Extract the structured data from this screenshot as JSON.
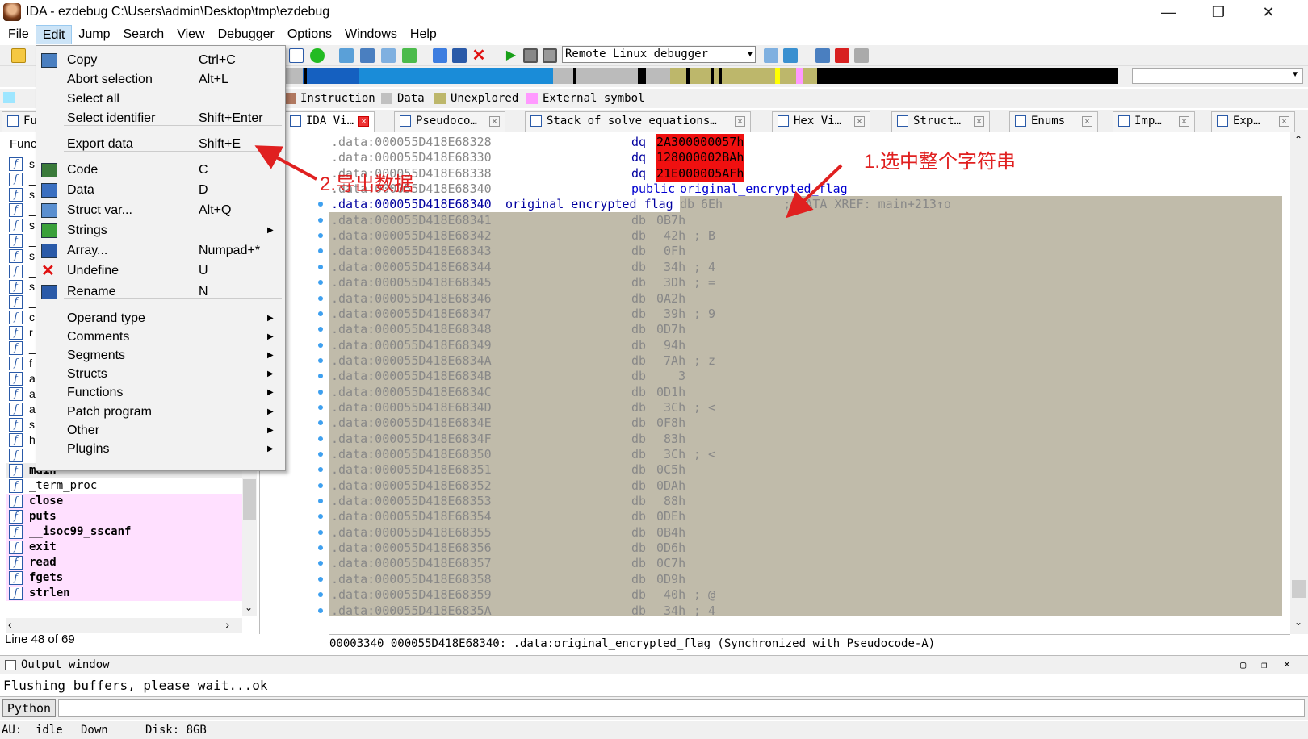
{
  "window": {
    "title": "IDA - ezdebug C:\\Users\\admin\\Desktop\\tmp\\ezdebug",
    "minimize": "—",
    "restore": "❐",
    "close": "✕"
  },
  "menubar": {
    "items": [
      "File",
      "Edit",
      "Jump",
      "Search",
      "View",
      "Debugger",
      "Options",
      "Windows",
      "Help"
    ],
    "active": "Edit"
  },
  "toolbar": {
    "debugger_select": "Remote Linux debugger"
  },
  "legend": [
    {
      "label": "Instruction",
      "color": "#b07860"
    },
    {
      "label": "Data",
      "color": "#c0c0c0"
    },
    {
      "label": "Unexplored",
      "color": "#bdb76b"
    },
    {
      "label": "External symbol",
      "color": "#ff99ff"
    }
  ],
  "tabs": [
    {
      "label": "Fu"
    },
    {
      "label": "IDA Vi…",
      "active": true
    },
    {
      "label": "Pseudoco…"
    },
    {
      "label": "Stack of solve_equations…"
    },
    {
      "label": "Hex Vi…"
    },
    {
      "label": "Struct…"
    },
    {
      "label": "Enums"
    },
    {
      "label": "Imp…"
    },
    {
      "label": "Exp…"
    }
  ],
  "functions_panel": {
    "header": "Func",
    "partial_rows": [
      "s",
      "_",
      "s",
      "_",
      "s",
      "_",
      "s",
      "_",
      "s",
      "_",
      "c",
      "r",
      "_",
      "f",
      "a",
      "a",
      "a",
      "s",
      "h"
    ],
    "rows": [
      {
        "name": "_pre_pad",
        "style": "normal"
      },
      {
        "name": "main",
        "style": "bold"
      },
      {
        "name": "_term_proc",
        "style": "normal"
      },
      {
        "name": "close",
        "style": "pink"
      },
      {
        "name": "puts",
        "style": "pink"
      },
      {
        "name": "__isoc99_sscanf",
        "style": "pink"
      },
      {
        "name": "exit",
        "style": "pink"
      },
      {
        "name": "read",
        "style": "pink"
      },
      {
        "name": "fgets",
        "style": "pink"
      },
      {
        "name": "strlen",
        "style": "pink"
      }
    ],
    "line_info": "Line 48 of 69"
  },
  "edit_menu": {
    "items": [
      {
        "label": "Copy",
        "shortcut": "Ctrl+C",
        "icon": "copy-icon"
      },
      {
        "label": "Abort selection",
        "shortcut": "Alt+L"
      },
      {
        "label": "Select all",
        "shortcut": ""
      },
      {
        "label": "Select identifier",
        "shortcut": "Shift+Enter"
      },
      {
        "label": "Export data",
        "shortcut": "Shift+E",
        "highlighted": true
      },
      {
        "label": "Code",
        "shortcut": "C",
        "icon": "code-icon"
      },
      {
        "label": "Data",
        "shortcut": "D",
        "icon": "data-icon"
      },
      {
        "label": "Struct var...",
        "shortcut": "Alt+Q",
        "icon": "struct-var-icon"
      },
      {
        "label": "Strings",
        "shortcut": "",
        "submenu": true,
        "icon": "strings-icon"
      },
      {
        "label": "Array...",
        "shortcut": "Numpad+*",
        "icon": "array-icon"
      },
      {
        "label": "Undefine",
        "shortcut": "U",
        "icon": "undefine-icon"
      },
      {
        "label": "Rename",
        "shortcut": "N",
        "icon": "rename-icon"
      },
      {
        "label": "Operand type",
        "submenu": true
      },
      {
        "label": "Comments",
        "submenu": true
      },
      {
        "label": "Segments",
        "submenu": true
      },
      {
        "label": "Structs",
        "submenu": true
      },
      {
        "label": "Functions",
        "submenu": true
      },
      {
        "label": "Patch program",
        "submenu": true
      },
      {
        "label": "Other",
        "submenu": true
      },
      {
        "label": "Plugins",
        "submenu": true
      }
    ]
  },
  "listing": {
    "rows": [
      {
        "addr": ".data:000055D418E68328",
        "name": "",
        "op": "dq",
        "val": "2A300000057h",
        "cmt": "",
        "red": true
      },
      {
        "addr": ".data:000055D418E68330",
        "name": "",
        "op": "dq",
        "val": "128000002BAh",
        "cmt": "",
        "red": true
      },
      {
        "addr": ".data:000055D418E68338",
        "name": "",
        "op": "dq",
        "val": "21E000005AFh",
        "cmt": "",
        "red": true
      },
      {
        "addr": ".data:000055D418E68340",
        "name": "",
        "op": "public",
        "val": "original_encrypted_flag",
        "cmt": "",
        "public": true
      },
      {
        "addr": ".data:000055D418E68340",
        "name": "original_encrypted_flag",
        "op": "db",
        "val": "6Eh",
        "cmt": "        ; DATA XREF: main+213↑o",
        "sel": true,
        "first": true
      },
      {
        "addr": ".data:000055D418E68341",
        "op": "db",
        "val": "0B7h",
        "cmt": "",
        "sel": true
      },
      {
        "addr": ".data:000055D418E68342",
        "op": "db",
        "val": " 42h",
        "cmt": "; B",
        "sel": true
      },
      {
        "addr": ".data:000055D418E68343",
        "op": "db",
        "val": " 0Fh",
        "cmt": "",
        "sel": true
      },
      {
        "addr": ".data:000055D418E68344",
        "op": "db",
        "val": " 34h",
        "cmt": "; 4",
        "sel": true
      },
      {
        "addr": ".data:000055D418E68345",
        "op": "db",
        "val": " 3Dh",
        "cmt": "; =",
        "sel": true
      },
      {
        "addr": ".data:000055D418E68346",
        "op": "db",
        "val": "0A2h",
        "cmt": "",
        "sel": true
      },
      {
        "addr": ".data:000055D418E68347",
        "op": "db",
        "val": " 39h",
        "cmt": "; 9",
        "sel": true
      },
      {
        "addr": ".data:000055D418E68348",
        "op": "db",
        "val": "0D7h",
        "cmt": "",
        "sel": true
      },
      {
        "addr": ".data:000055D418E68349",
        "op": "db",
        "val": " 94h",
        "cmt": "",
        "sel": true
      },
      {
        "addr": ".data:000055D418E6834A",
        "op": "db",
        "val": " 7Ah",
        "cmt": "; z",
        "sel": true
      },
      {
        "addr": ".data:000055D418E6834B",
        "op": "db",
        "val": "   3",
        "cmt": "",
        "sel": true
      },
      {
        "addr": ".data:000055D418E6834C",
        "op": "db",
        "val": "0D1h",
        "cmt": "",
        "sel": true
      },
      {
        "addr": ".data:000055D418E6834D",
        "op": "db",
        "val": " 3Ch",
        "cmt": "; <",
        "sel": true
      },
      {
        "addr": ".data:000055D418E6834E",
        "op": "db",
        "val": "0F8h",
        "cmt": "",
        "sel": true
      },
      {
        "addr": ".data:000055D418E6834F",
        "op": "db",
        "val": " 83h",
        "cmt": "",
        "sel": true
      },
      {
        "addr": ".data:000055D418E68350",
        "op": "db",
        "val": " 3Ch",
        "cmt": "; <",
        "sel": true
      },
      {
        "addr": ".data:000055D418E68351",
        "op": "db",
        "val": "0C5h",
        "cmt": "",
        "sel": true
      },
      {
        "addr": ".data:000055D418E68352",
        "op": "db",
        "val": "0DAh",
        "cmt": "",
        "sel": true
      },
      {
        "addr": ".data:000055D418E68353",
        "op": "db",
        "val": " 88h",
        "cmt": "",
        "sel": true
      },
      {
        "addr": ".data:000055D418E68354",
        "op": "db",
        "val": "0DEh",
        "cmt": "",
        "sel": true
      },
      {
        "addr": ".data:000055D418E68355",
        "op": "db",
        "val": "0B4h",
        "cmt": "",
        "sel": true
      },
      {
        "addr": ".data:000055D418E68356",
        "op": "db",
        "val": "0D6h",
        "cmt": "",
        "sel": true
      },
      {
        "addr": ".data:000055D418E68357",
        "op": "db",
        "val": "0C7h",
        "cmt": "",
        "sel": true
      },
      {
        "addr": ".data:000055D418E68358",
        "op": "db",
        "val": "0D9h",
        "cmt": "",
        "sel": true
      },
      {
        "addr": ".data:000055D418E68359",
        "op": "db",
        "val": " 40h",
        "cmt": "; @",
        "sel": true
      },
      {
        "addr": ".data:000055D418E6835A",
        "op": "db",
        "val": " 34h",
        "cmt": "; 4",
        "sel": true
      }
    ],
    "status": "00003340 000055D418E68340: .data:original_encrypted_flag (Synchronized with Pseudocode-A)"
  },
  "annotations": {
    "select_string": "1.选中整个字符串",
    "export_data": "2.导出数据"
  },
  "output": {
    "title": "Output window",
    "text": "Flushing buffers, please wait...ok",
    "python_button": "Python"
  },
  "statusbar": {
    "au": "AU:",
    "state": "idle",
    "direction": "Down",
    "disk": "Disk: 8GB"
  }
}
